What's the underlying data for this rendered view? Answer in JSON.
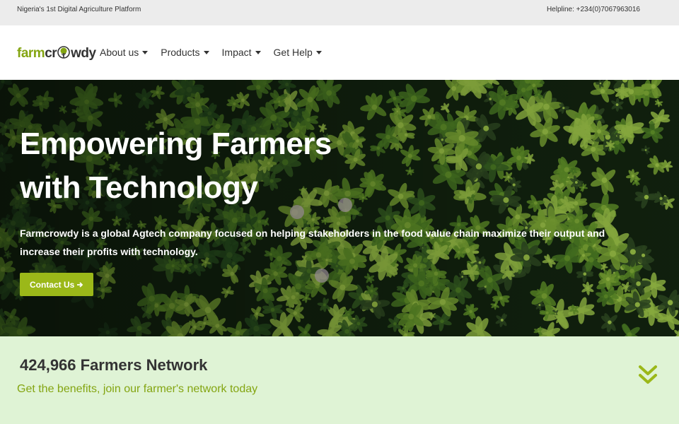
{
  "topbar": {
    "tagline": "Nigeria's 1st Digital Agriculture Platform",
    "helpline": "Helpline: +234(0)7067963016"
  },
  "logo": {
    "part1": "farm",
    "part2": "cr",
    "part3": "wdy"
  },
  "nav": {
    "items": [
      {
        "label": "About us"
      },
      {
        "label": "Products"
      },
      {
        "label": "Impact"
      },
      {
        "label": "Get Help"
      }
    ]
  },
  "hero": {
    "title_line1": "Empowering Farmers",
    "title_line2": "with Technology",
    "description": "Farmcrowdy is a global Agtech company focused on helping stakeholders in the food value chain maximize their output and increase their profits with technology.",
    "cta_label": "Contact Us",
    "cta_icon": "arrow-right-icon"
  },
  "network": {
    "count_text": "424,966 Farmers Network",
    "subtitle": "Get the benefits, join our farmer's network today"
  },
  "colors": {
    "brand_green": "#84a512",
    "button_green": "#9bb819",
    "band_bg": "#dff3d5",
    "topbar_bg": "#ececec"
  }
}
